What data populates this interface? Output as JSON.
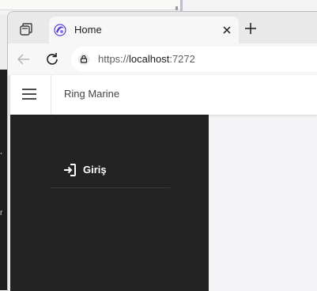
{
  "browser": {
    "tab": {
      "title": "Home"
    },
    "address_bar": {
      "url_prefix": "https://",
      "url_host": "localhost",
      "url_port": ":7272"
    }
  },
  "app": {
    "brand": "Ring Marine",
    "nav": [
      {
        "label": "Giriş",
        "icon": "login-icon"
      }
    ]
  },
  "colors": {
    "sidebar_bg": "#232323",
    "main_bg": "#f4f4f6",
    "favicon_accent": "#5b3fd0"
  },
  "background_window": {
    "glyphs": [
      "¸",
      "r"
    ]
  }
}
